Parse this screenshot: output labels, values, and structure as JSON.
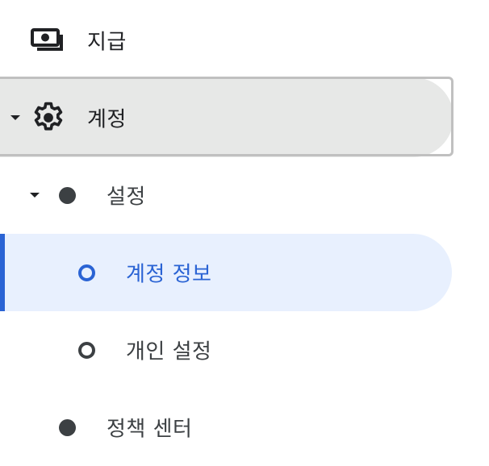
{
  "nav": {
    "items": [
      {
        "label": "지급",
        "icon": "payments-icon",
        "level": 0
      },
      {
        "label": "계정",
        "icon": "gear-icon",
        "level": 0,
        "expanded": true,
        "focused": true
      },
      {
        "label": "설정",
        "icon": "filled-dot-icon",
        "level": 1,
        "expanded": true
      },
      {
        "label": "계정 정보",
        "icon": "ring-icon",
        "level": 2,
        "selected": true
      },
      {
        "label": "개인 설정",
        "icon": "ring-icon",
        "level": 2
      },
      {
        "label": "정책 센터",
        "icon": "filled-dot-icon",
        "level": 1
      }
    ]
  },
  "colors": {
    "selected_text": "#2a63d4",
    "selected_bg": "#e8f0fe",
    "focused_bg": "#e7e8e7",
    "text": "#3c4043",
    "icon": "#202124"
  }
}
